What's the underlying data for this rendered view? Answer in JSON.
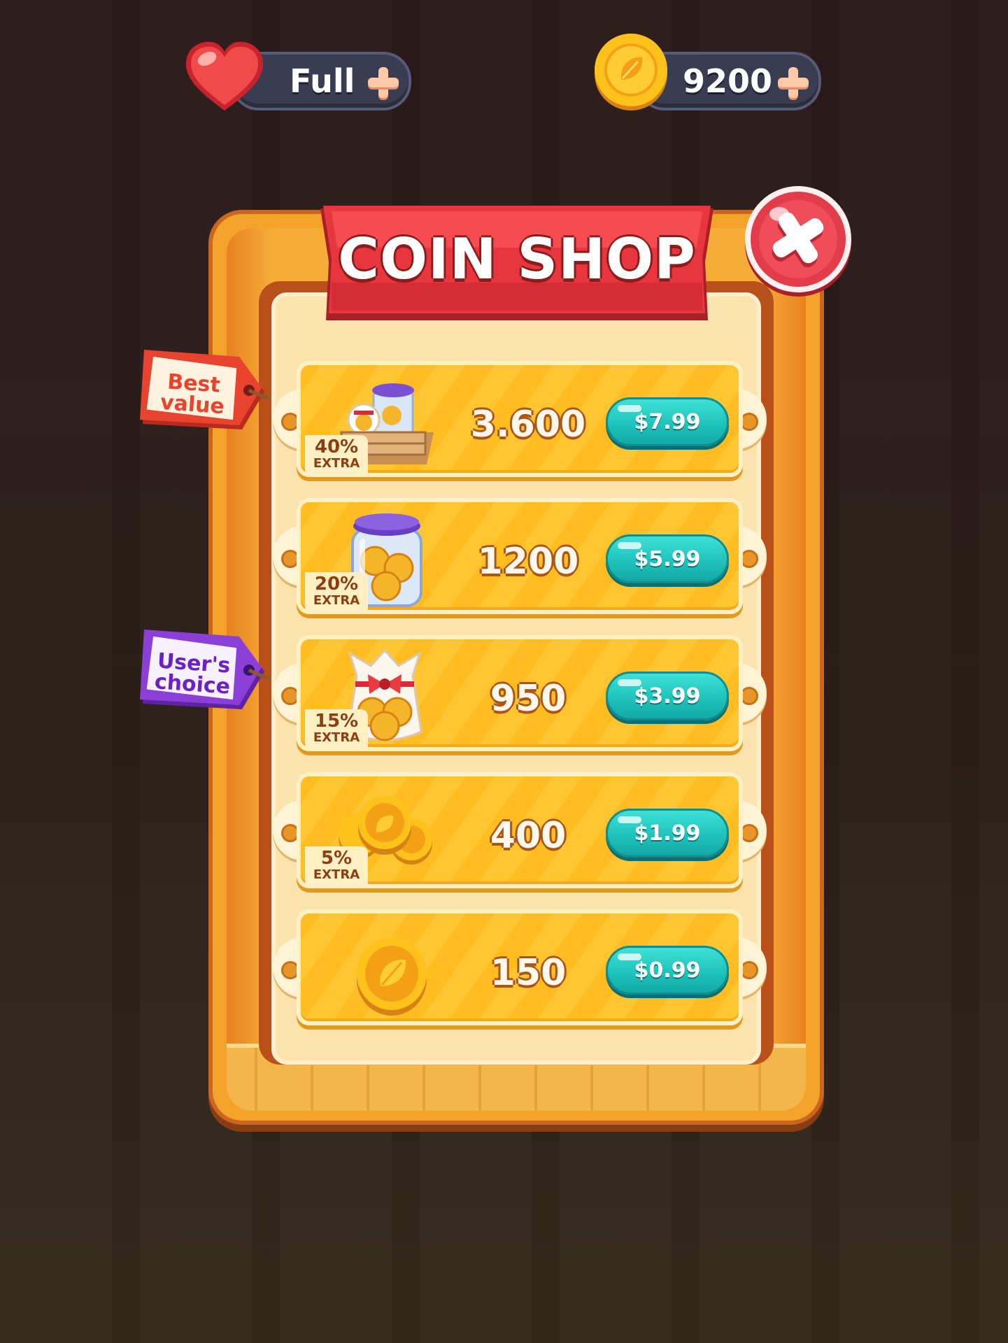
{
  "hud": {
    "lives_value": "Full",
    "coins_value": "9200"
  },
  "shop": {
    "title": "COIN SHOP",
    "items": [
      {
        "amount": "3.600",
        "price": "$7.99",
        "extra_pct": "40%",
        "extra_label": "EXTRA",
        "icon": "coin-box-icon"
      },
      {
        "amount": "1200",
        "price": "$5.99",
        "extra_pct": "20%",
        "extra_label": "EXTRA",
        "icon": "coin-jar-icon"
      },
      {
        "amount": "950",
        "price": "$3.99",
        "extra_pct": "15%",
        "extra_label": "EXTRA",
        "icon": "coin-bag-icon"
      },
      {
        "amount": "400",
        "price": "$1.99",
        "extra_pct": "5%",
        "extra_label": "EXTRA",
        "icon": "coin-stack-icon"
      },
      {
        "amount": "150",
        "price": "$0.99",
        "icon": "single-coin-icon"
      }
    ],
    "tags": {
      "best_value_line1": "Best",
      "best_value_line2": "value",
      "users_choice_line1": "User's",
      "users_choice_line2": "choice"
    }
  },
  "colors": {
    "frame_orange": "#f3a32a",
    "ribbon_red": "#e8363f",
    "buy_teal": "#1fc3bb",
    "close_red": "#e23b4a",
    "best_tag": "#e8432e",
    "choice_tag": "#8b3fd6"
  }
}
